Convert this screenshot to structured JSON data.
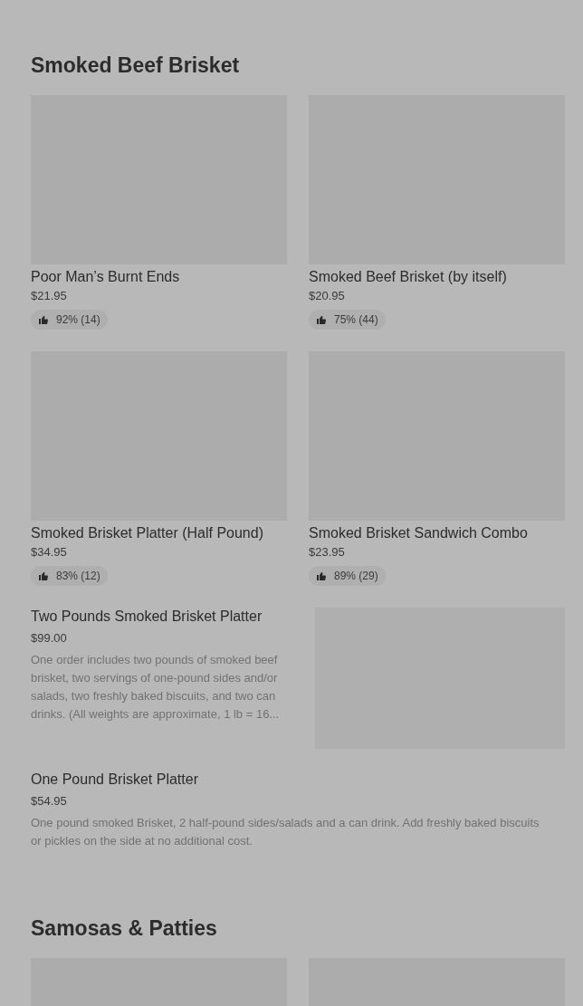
{
  "sections": [
    {
      "title": "Smoked Beef Brisket",
      "items": [
        {
          "kind": "card",
          "name": "Poor Man’s Burnt Ends",
          "price": "$21.95",
          "rating": "92% (14)"
        },
        {
          "kind": "card",
          "name": "Smoked Beef Brisket (by itself)",
          "price": "$20.95",
          "rating": "75% (44)"
        },
        {
          "kind": "card",
          "name": "Smoked Brisket Platter (Half Pound)",
          "price": "$34.95",
          "rating": "83% (12)"
        },
        {
          "kind": "card",
          "name": "Smoked Brisket Sandwich Combo",
          "price": "$23.95",
          "rating": "89% (29)"
        },
        {
          "kind": "row",
          "name": "Two Pounds Smoked Brisket Platter",
          "price": "$99.00",
          "description": "One order includes two pounds of smoked beef brisket, two servings of one-pound sides and/or salads, two freshly baked biscuits, and two can drinks. (All weights are approximate, 1 lb = 16...",
          "image": true
        },
        {
          "kind": "row",
          "name": "One Pound Brisket Platter",
          "price": "$54.95",
          "description": "One pound smoked Brisket, 2 half-pound sides/salads and a can drink. Add freshly baked biscuits or pickles on the side at no additional cost.",
          "image": false
        }
      ]
    },
    {
      "title": "Samosas & Patties",
      "items": [
        {
          "kind": "image_only"
        },
        {
          "kind": "image_only"
        }
      ]
    }
  ]
}
